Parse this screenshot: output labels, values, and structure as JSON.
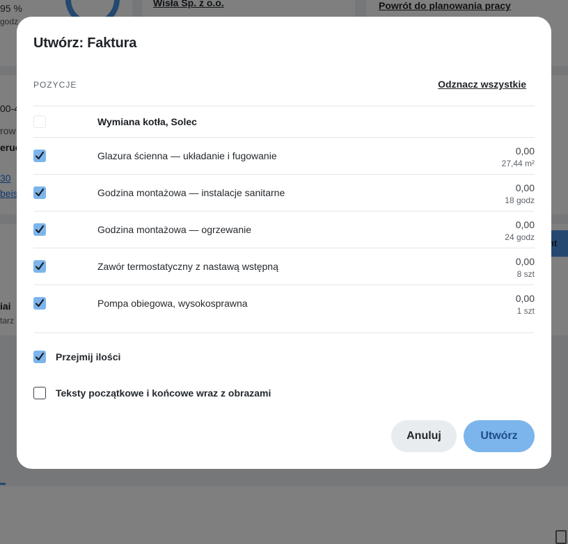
{
  "background": {
    "card1": {
      "percent": "95 %",
      "hours": "godz"
    },
    "card2": {
      "company": "Wisła Sp. z o.o."
    },
    "card3": {
      "back_link": "Powrót do planowania pracy"
    },
    "left_fragments": [
      "00-4",
      "row",
      "eruc",
      "30",
      "beis"
    ],
    "row_fragments": [
      "iai",
      "tarz"
    ],
    "pill_fragment": "nt"
  },
  "modal": {
    "title": "Utwórz: Faktura",
    "section_label": "POZYCJE",
    "deselect_all": "Odznacz wszystkie",
    "group": {
      "label": "Wymiana kotła, Solec",
      "checked": false
    },
    "items": [
      {
        "label": "Glazura ścienna — układanie i fugowanie",
        "amount": "0,00",
        "quantity": "27,44 m²",
        "checked": true
      },
      {
        "label": "Godzina montażowa — instalacje sanitarne",
        "amount": "0,00",
        "quantity": "18 godz",
        "checked": true
      },
      {
        "label": "Godzina montażowa — ogrzewanie",
        "amount": "0,00",
        "quantity": "24 godz",
        "checked": true
      },
      {
        "label": "Zawór termostatyczny z nastawą wstępną",
        "amount": "0,00",
        "quantity": "8 szt",
        "checked": true
      },
      {
        "label": "Pompa obiegowa, wysokosprawna",
        "amount": "0,00",
        "quantity": "1 szt",
        "checked": true
      }
    ],
    "options": [
      {
        "label": "Przejmij ilości",
        "checked": true
      },
      {
        "label": "Teksty początkowe i końcowe wraz z obrazami",
        "checked": false
      }
    ],
    "buttons": {
      "cancel": "Anuluj",
      "create": "Utwórz"
    }
  },
  "colors": {
    "accent": "#7cb5ec",
    "overlay": "#7f7f80"
  }
}
